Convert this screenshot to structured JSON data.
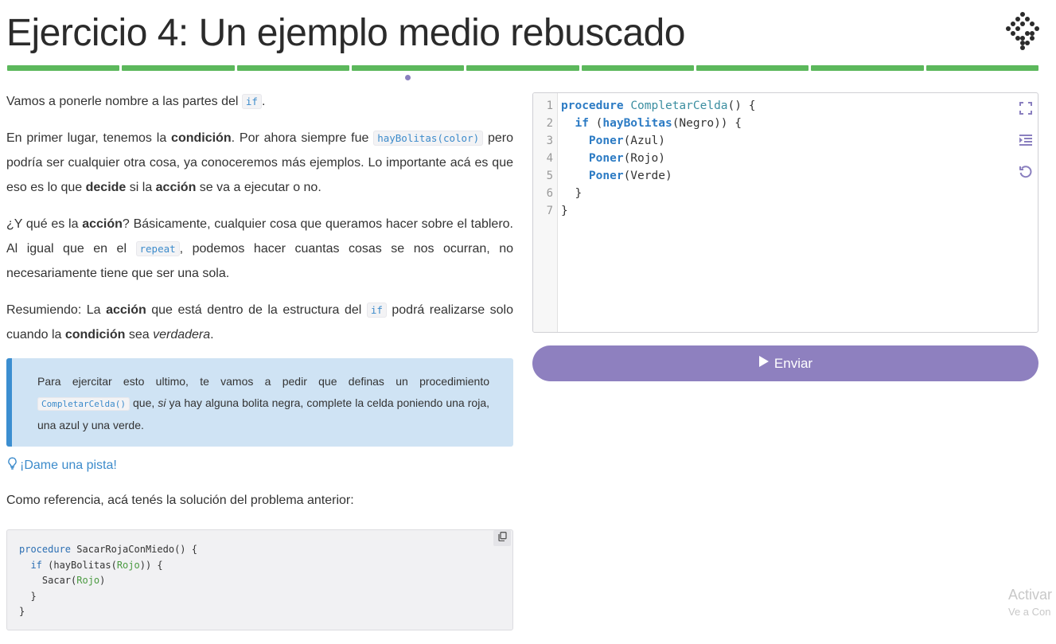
{
  "header": {
    "title": "Ejercicio 4: Un ejemplo medio rebuscado",
    "logo_icon": "mumuki-logo-icon"
  },
  "progress": {
    "segments": 9,
    "current_index": 3,
    "complete_color": "#5cb85c",
    "current_marker_color": "#8a7fbf"
  },
  "content": {
    "p1": {
      "t1": "Vamos a ponerle nombre a las partes del ",
      "code1": "if",
      "t2": "."
    },
    "p2": {
      "t1": "En primer lugar, tenemos la ",
      "b1": "condición",
      "t2": ". Por ahora siempre fue ",
      "code1": "hayBolitas(color)",
      "t3": " pero podría ser cualquier otra cosa, ya conoceremos más ejemplos. Lo importante acá es que eso es lo que ",
      "b2": "decide",
      "t4": " si la ",
      "b3": "acción",
      "t5": " se va a ejecutar o no."
    },
    "p3": {
      "t1": "¿Y qué es la ",
      "b1": "acción",
      "t2": "? Básicamente, cualquier cosa que queramos hacer sobre el tablero. Al igual que en el ",
      "code1": "repeat",
      "t3": ", podemos hacer cuantas cosas se nos ocurran, no necesariamente tiene que ser una sola."
    },
    "p4": {
      "t1": "Resumiendo: La ",
      "b1": "acción",
      "t2": " que está dentro de la estructura del ",
      "code1": "if",
      "t3": " podrá realizarse solo cuando la ",
      "b2": "condición",
      "t4": " sea ",
      "i1": "verdadera",
      "t5": "."
    },
    "callout": {
      "t1": "Para ejercitar esto ultimo, te vamos a pedir que definas un procedimiento ",
      "code1": "CompletarCelda()",
      "t2": " que, ",
      "i1": "si",
      "t3": " ya hay alguna bolita negra, complete la celda poniendo una roja, una azul y una verde."
    },
    "hint_label": "¡Dame una pista!",
    "reference_text": "Como referencia, acá tenés la solución del problema anterior:",
    "reference_code": {
      "l1_kw": "procedure",
      "l1_rest": " SacarRojaConMiedo() {",
      "l2_kw": "  if",
      "l2_a": " (hayBolitas(",
      "l2_g": "Rojo",
      "l2_b": ")) {",
      "l3_a": "    Sacar(",
      "l3_g": "Rojo",
      "l3_b": ")",
      "l4": "  }",
      "l5": "}"
    }
  },
  "editor": {
    "line_numbers": [
      "1",
      "2",
      "3",
      "4",
      "5",
      "6",
      "7"
    ],
    "lines": {
      "l1_kw": "procedure",
      "l1_name": "CompletarCelda",
      "l1_rest": "() {",
      "l2_kw": "  if",
      "l2_a": " (",
      "l2_fn": "hayBolitas",
      "l2_b": "(Negro)) {",
      "l3_fn": "    Poner",
      "l3_b": "(Azul)",
      "l4_fn": "    Poner",
      "l4_b": "(Rojo)",
      "l5_fn": "    Poner",
      "l5_b": "(Verde)",
      "l6": "  }",
      "l7": "}"
    },
    "tools": [
      "fullscreen-icon",
      "indent-icon",
      "reset-icon"
    ]
  },
  "submit": {
    "label": "Enviar",
    "icon": "play-icon",
    "color": "#8e80bf"
  },
  "watermark": {
    "line1": "Activar",
    "line2": "Ve a Con"
  }
}
